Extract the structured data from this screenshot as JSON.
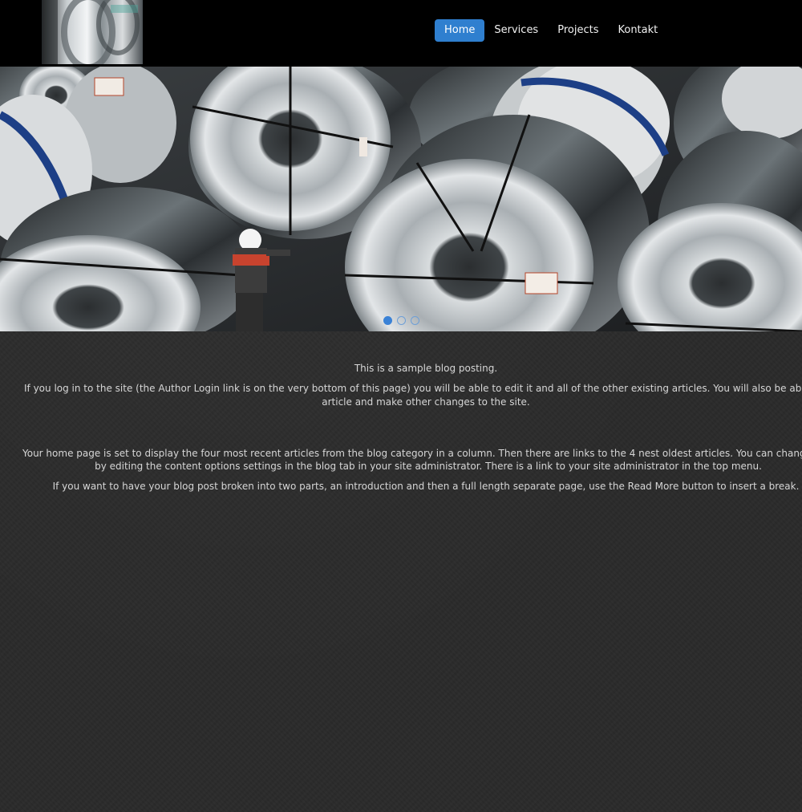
{
  "header": {
    "nav": [
      {
        "label": "Home",
        "active": true
      },
      {
        "label": "Services",
        "active": false
      },
      {
        "label": "Projects",
        "active": false
      },
      {
        "label": "Kontakt",
        "active": false
      }
    ]
  },
  "slider": {
    "slide_count": 3,
    "active_slide": 1
  },
  "article": {
    "p1": "This is a sample blog posting.",
    "p2_line1": "If you log in to the site (the Author Login link is on the very bottom of this page) you will be able to edit it and all of the other existing articles. You will also be able to create a",
    "p2_line2": "article and make other changes to the site.",
    "p3_line1": "Your home page is set to display the four most recent articles from the blog category in a column. Then there are links to the 4 nest oldest articles. You can change those nur",
    "p3_line2": "by editing the content options settings in the blog tab in your site administrator. There is a link to your site administrator in the top menu.",
    "p4": "If you want to have your blog post broken into two parts, an introduction and then a full length separate page, use the Read More button to insert a break."
  },
  "colors": {
    "header_bg": "#000000",
    "nav_active": "#2f7fcf",
    "body_bg": "#2b2b2b",
    "text": "#d6d6d6"
  }
}
